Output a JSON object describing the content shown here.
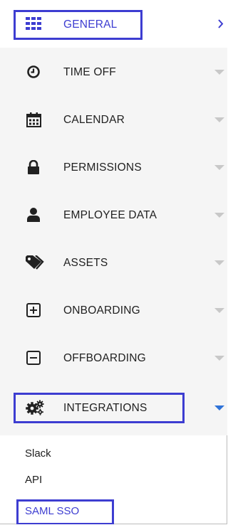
{
  "menu": {
    "general": {
      "label": "GENERAL",
      "icon": "grid-icon",
      "chevron": "chevron-right-icon",
      "color": "#3d3dd1"
    },
    "items": [
      {
        "label": "TIME OFF",
        "icon": "clock-icon"
      },
      {
        "label": "CALENDAR",
        "icon": "calendar-icon"
      },
      {
        "label": "PERMISSIONS",
        "icon": "lock-icon"
      },
      {
        "label": "EMPLOYEE DATA",
        "icon": "person-icon"
      },
      {
        "label": "ASSETS",
        "icon": "tags-icon"
      },
      {
        "label": "ONBOARDING",
        "icon": "plus-box-icon"
      },
      {
        "label": "OFFBOARDING",
        "icon": "minus-box-icon"
      },
      {
        "label": "INTEGRATIONS",
        "icon": "gears-icon"
      }
    ],
    "integrations_sub": [
      {
        "label": "Slack"
      },
      {
        "label": "API"
      },
      {
        "label": "SAML SSO"
      }
    ]
  },
  "colors": {
    "accent": "#3d3dd1",
    "highlight_border": "#3d3dd1",
    "caret_gray": "#c8c8c8",
    "caret_active": "#2f73d8",
    "row_gray": "#f5f5f5"
  }
}
